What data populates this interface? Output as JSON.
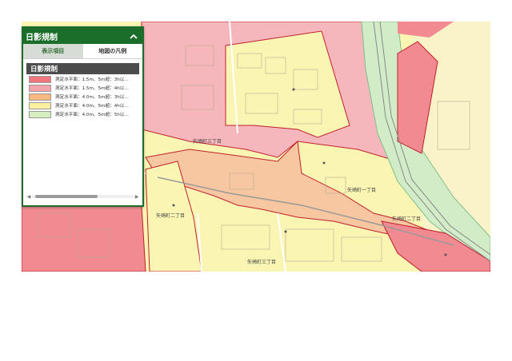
{
  "map": {
    "labels": {
      "area_1": "矢崎町三丁目",
      "area_2": "矢崎町二丁目",
      "area_3": "矢崎町一丁目",
      "area_4": "矢崎町二丁目",
      "area_5": "矢崎町三丁目"
    },
    "colors": {
      "zone_red": "#f18b91",
      "zone_pink": "#f6b7bc",
      "zone_orange": "#f6c7a0",
      "zone_yellow": "#fbf5b4",
      "zone_green": "#d2ecc8",
      "boundary": "#c01f2c"
    }
  },
  "panel": {
    "title": "日影規制",
    "collapse_icon": "chevron-up-icon",
    "tabs": [
      {
        "label": "表示項目",
        "active": true
      },
      {
        "label": "地図の凡例",
        "active": false
      }
    ],
    "section_title": "日影規制",
    "legend": [
      {
        "label": "測定水平面：1.5m、5m超：3h以…",
        "color": "#f0757d"
      },
      {
        "label": "測定水平面：1.5m、5m超：4h以…",
        "color": "#f4a3aa"
      },
      {
        "label": "測定水平面：4.0m、5m超：3h以…",
        "color": "#f7b97f"
      },
      {
        "label": "測定水平面：4.0m、5m超：4h以…",
        "color": "#fbf0a0"
      },
      {
        "label": "測定水平面：4.0m、5m超：5h以…",
        "color": "#d7efbe"
      }
    ]
  }
}
